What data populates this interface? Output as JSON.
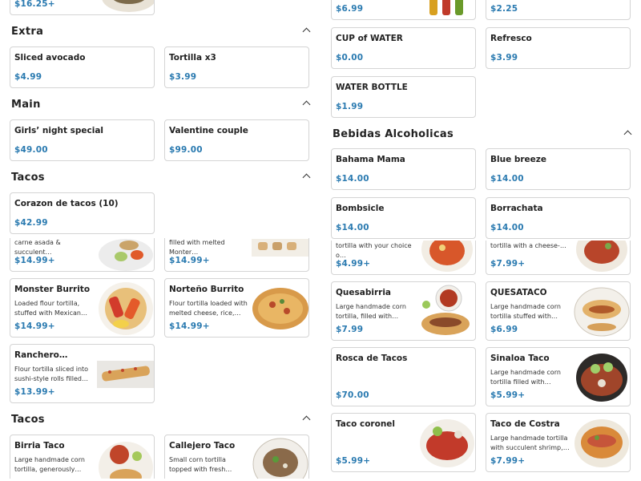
{
  "left": {
    "top_partial": {
      "price": "$16.25+"
    },
    "extra": {
      "title": "Extra",
      "items": [
        {
          "name": "Sliced avocado",
          "price": "$4.99"
        },
        {
          "name": "Tortilla x3",
          "price": "$3.99"
        }
      ]
    },
    "main": {
      "title": "Main",
      "items": [
        {
          "name": "Girls’ night special",
          "price": "$49.00"
        },
        {
          "name": "Valentine couple",
          "price": "$99.00"
        }
      ]
    },
    "tacos_a": {
      "title": "Tacos",
      "items": [
        {
          "name": "Corazon de tacos (10)",
          "price": "$42.99"
        }
      ]
    },
    "burritos": {
      "partial": [
        {
          "desc": "carne asada & succulent…",
          "price": "$14.99+"
        },
        {
          "desc": "filled with melted Monter…",
          "price": "$14.99+"
        }
      ],
      "items": [
        {
          "name": "Monster Burrito",
          "desc": "Loaded flour tortilla, stuffed with Mexican rice,…",
          "price": "$14.99+"
        },
        {
          "name": "Norteño Burrito",
          "desc": "Flour tortilla loaded with melted cheese, rice, and…",
          "price": "$14.99+"
        },
        {
          "name": "Ranchero…",
          "desc": "Flour tortilla sliced into sushi-style rolls filled wit…",
          "price": "$13.99+"
        }
      ]
    },
    "tacos_b": {
      "title": "Tacos",
      "items": [
        {
          "name": "Birria Taco",
          "desc": "Large handmade corn tortilla, generously filled…"
        },
        {
          "name": "Callejero Taco",
          "desc": "Small corn tortilla topped with fresh cilantro, onion…"
        }
      ]
    }
  },
  "right": {
    "drinks": {
      "partial": [
        {
          "price": "$6.99"
        },
        {
          "price": "$2.25"
        }
      ],
      "items": [
        {
          "name": "CUP of WATER",
          "price": "$0.00"
        },
        {
          "name": "Refresco",
          "price": "$3.99"
        },
        {
          "name": "WATER BOTTLE",
          "price": "$1.99"
        }
      ]
    },
    "alcohol": {
      "title": "Bebidas Alcoholicas",
      "items": [
        {
          "name": "Bahama Mama",
          "price": "$14.00"
        },
        {
          "name": "Blue breeze",
          "price": "$14.00"
        },
        {
          "name": "Bombsicle",
          "price": "$14.00"
        },
        {
          "name": "Borrachata",
          "price": "$14.00"
        }
      ]
    },
    "tacos": {
      "partial": [
        {
          "desc": "tortilla with your choice o…",
          "price": "$4.99+"
        },
        {
          "desc": "tortilla with a cheese-…",
          "price": "$7.99+"
        }
      ],
      "items": [
        {
          "name": "Quesabirria",
          "desc": "Large handmade corn tortilla, filled with tender,…",
          "price": "$7.99"
        },
        {
          "name": "QUESATACO",
          "desc": "Large handmade corn tortilla stuffed with…",
          "price": "$6.99"
        },
        {
          "name": "Rosca de Tacos",
          "price": "$70.00"
        },
        {
          "name": "Sinaloa Taco",
          "desc": "Large handmade corn tortilla filled with chilorio…",
          "price": "$5.99+"
        },
        {
          "name": "Taco coronel",
          "price": "$5.99+"
        },
        {
          "name": "Taco de Costra",
          "desc": "Large handmade tortilla with succulent shrimp, a…",
          "price": "$7.99+"
        }
      ]
    }
  }
}
